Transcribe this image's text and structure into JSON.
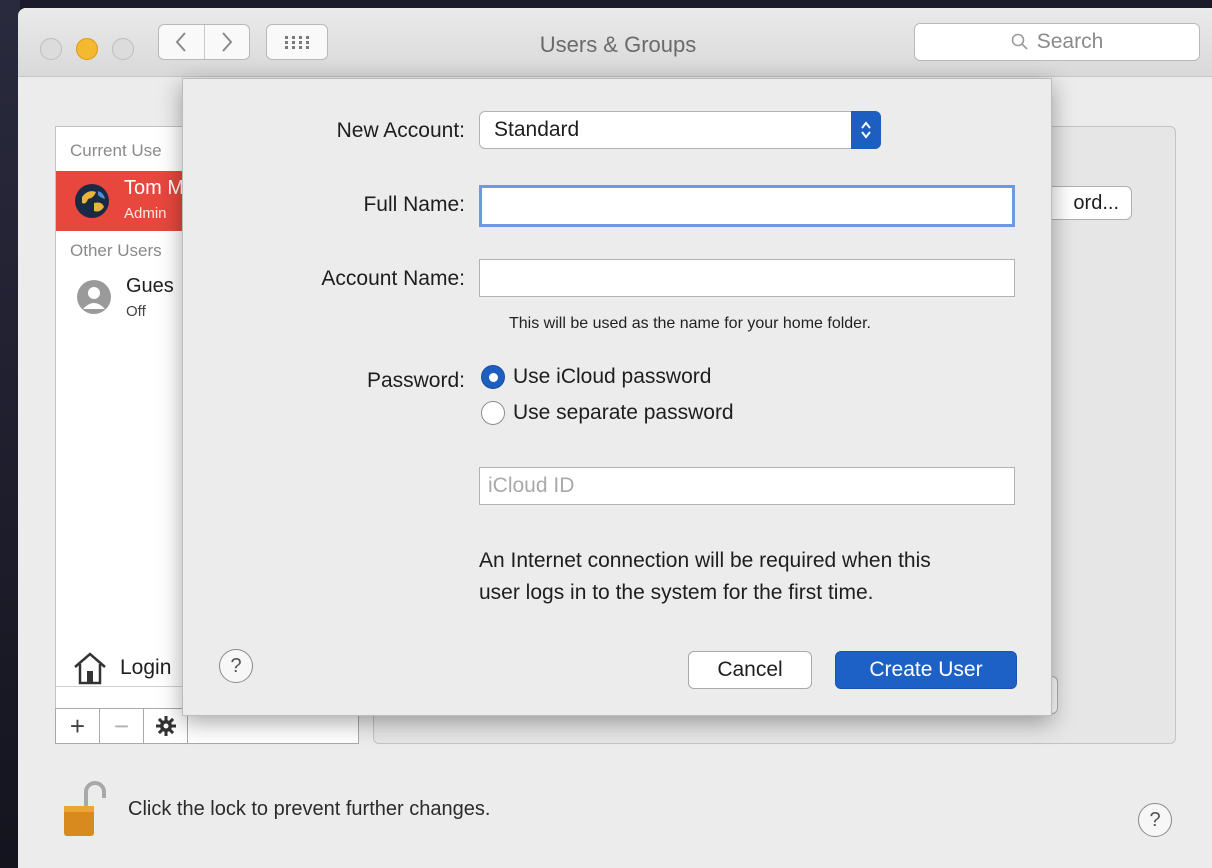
{
  "window": {
    "title": "Users & Groups",
    "search_placeholder": "Search"
  },
  "sidebar": {
    "current_users_header": "Current Use",
    "current_user": {
      "name": "Tom M",
      "role": "Admin"
    },
    "other_users_header": "Other Users",
    "guest_user": {
      "name": "Gues",
      "status": "Off"
    },
    "login_options_label": "Login",
    "add_label": "+",
    "remove_label": "−"
  },
  "background": {
    "change_password_fragment": "ord...",
    "lock_text": "Click the lock to prevent further changes."
  },
  "sheet": {
    "new_account_label": "New Account:",
    "account_type_value": "Standard",
    "full_name_label": "Full Name:",
    "full_name_value": "",
    "account_name_label": "Account Name:",
    "account_name_value": "",
    "account_name_hint": "This will be used as the name for your home folder.",
    "password_label": "Password:",
    "password_options": [
      {
        "label": "Use iCloud password",
        "selected": true
      },
      {
        "label": "Use separate password",
        "selected": false
      }
    ],
    "icloud_id_placeholder": "iCloud ID",
    "info_text_line1": "An Internet connection will be required when this",
    "info_text_line2": "user logs in to the system for the first time.",
    "help_label": "?",
    "cancel_label": "Cancel",
    "create_label": "Create User"
  },
  "colors": {
    "accent_blue": "#1e61c6",
    "selection_red": "#e8473e",
    "minimize_yellow": "#f4b92e"
  },
  "icons": [
    "back-icon",
    "forward-icon",
    "grid-icon",
    "search-icon",
    "globe-avatar-icon",
    "guest-avatar-icon",
    "house-icon",
    "gear-icon",
    "lock-icon",
    "help-icon",
    "stepper-icon"
  ]
}
